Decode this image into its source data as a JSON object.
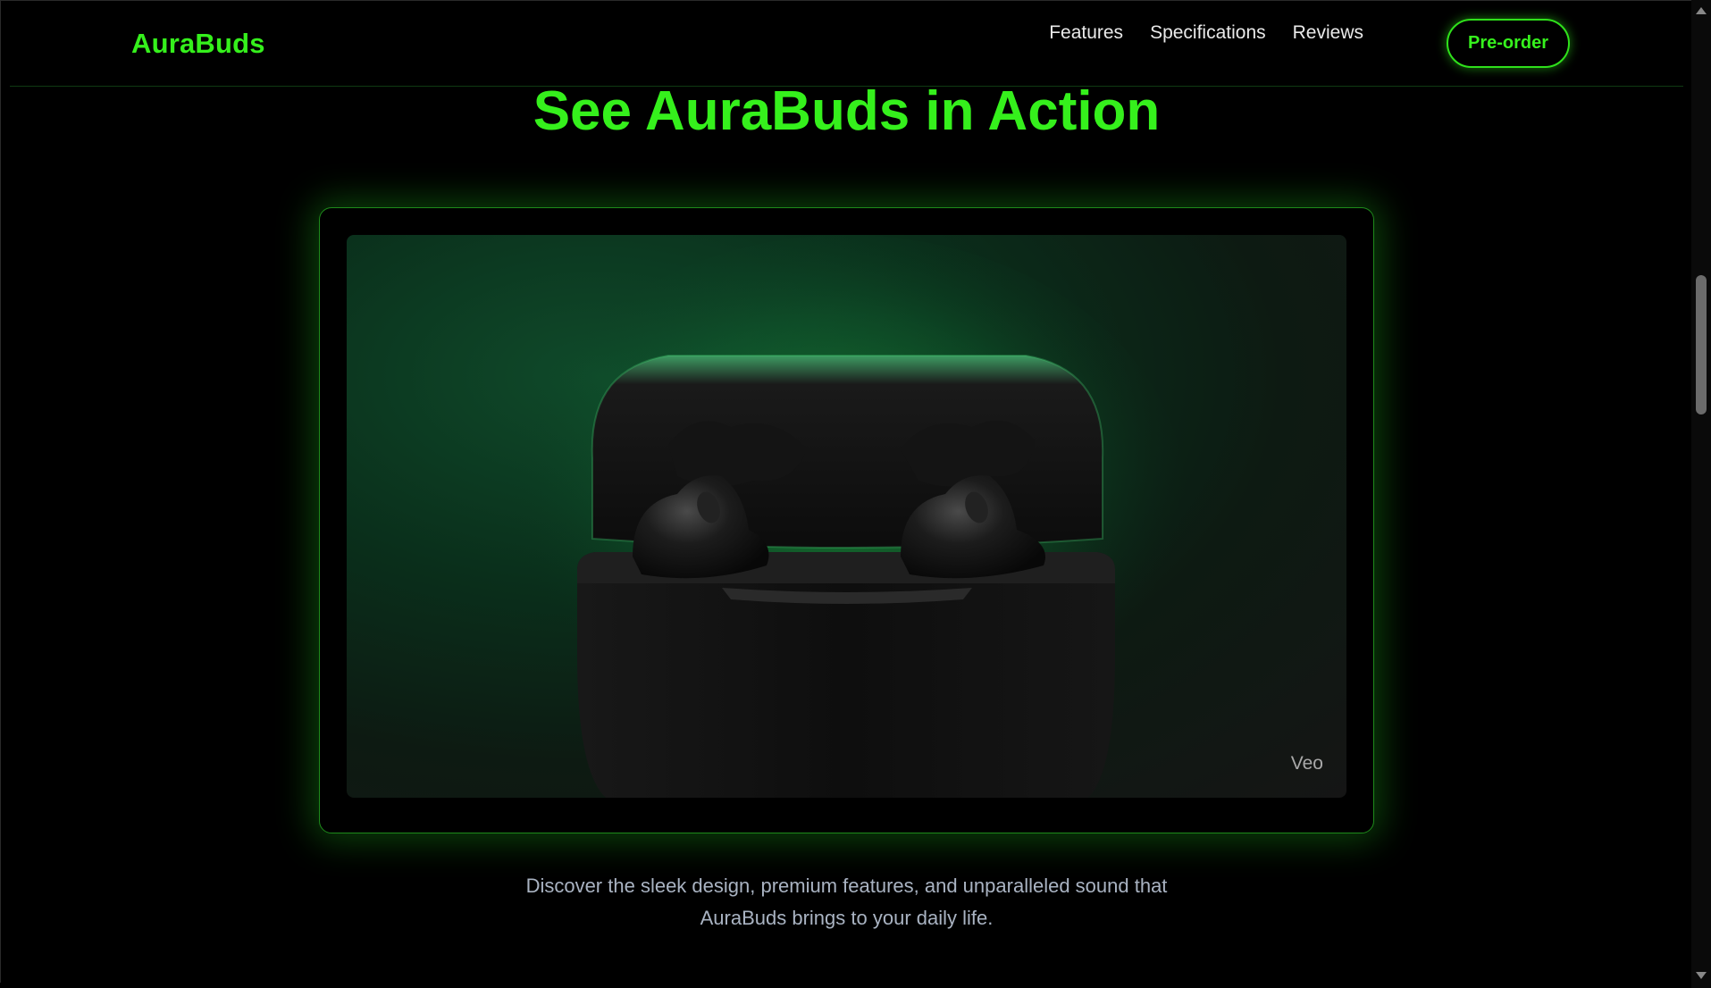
{
  "brand": {
    "name": "AuraBuds",
    "accent_color": "#35f01c"
  },
  "nav": {
    "links": [
      {
        "label": "Features"
      },
      {
        "label": "Specifications"
      },
      {
        "label": "Reviews"
      }
    ],
    "cta_label": "Pre-order"
  },
  "section": {
    "title": "See AuraBuds in Action",
    "video": {
      "watermark": "Veo"
    },
    "description_lines": [
      "Discover the sleek design, premium features, and unparalleled sound that",
      "AuraBuds brings to your daily life."
    ]
  }
}
